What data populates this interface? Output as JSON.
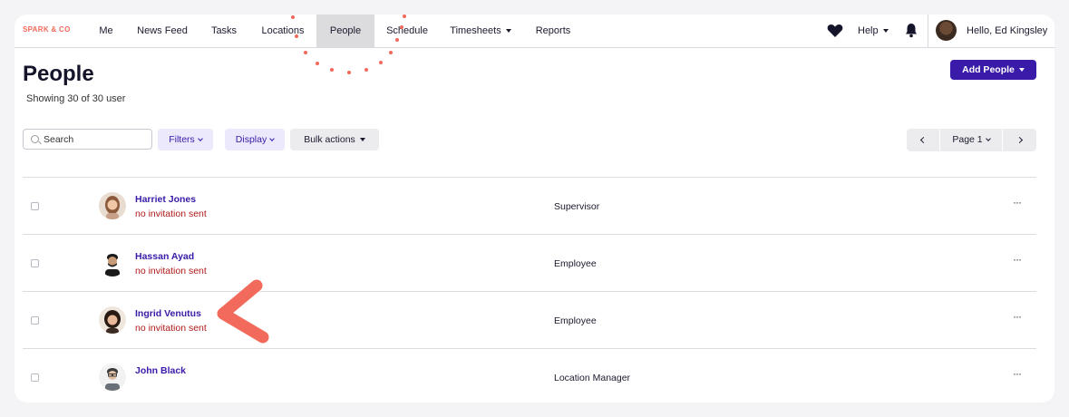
{
  "brand": "SPARK & CO",
  "nav": {
    "items": [
      {
        "label": "Me"
      },
      {
        "label": "News Feed"
      },
      {
        "label": "Tasks"
      },
      {
        "label": "Locations"
      },
      {
        "label": "People"
      },
      {
        "label": "Schedule"
      },
      {
        "label": "Timesheets"
      },
      {
        "label": "Reports"
      }
    ],
    "help_label": "Help",
    "greeting": "Hello, Ed Kingsley"
  },
  "page": {
    "title": "People",
    "showing": "Showing 30 of 30 user",
    "add_label": "Add People"
  },
  "toolbar": {
    "search_placeholder": "Search",
    "filters_label": "Filters",
    "display_label": "Display",
    "bulk_label": "Bulk actions",
    "page_label": "Page 1"
  },
  "rows": [
    {
      "name": "Harriet Jones",
      "status": "no invitation sent",
      "role": "Supervisor"
    },
    {
      "name": "Hassan Ayad",
      "status": "no invitation sent",
      "role": "Employee"
    },
    {
      "name": "Ingrid Venutus",
      "status": "no invitation sent",
      "role": "Employee"
    },
    {
      "name": "John Black",
      "status": "",
      "role": "Location Manager"
    }
  ],
  "more_glyph": "···",
  "colors": {
    "accent": "#3a1aa8",
    "brand": "#f26a5b",
    "warning": "#b01818",
    "annotation": "#f26a5b"
  },
  "icons": [
    "heart-icon",
    "bell-icon",
    "search-icon",
    "caret-down-icon",
    "chevron-left-icon",
    "chevron-right-icon",
    "more-icon"
  ]
}
